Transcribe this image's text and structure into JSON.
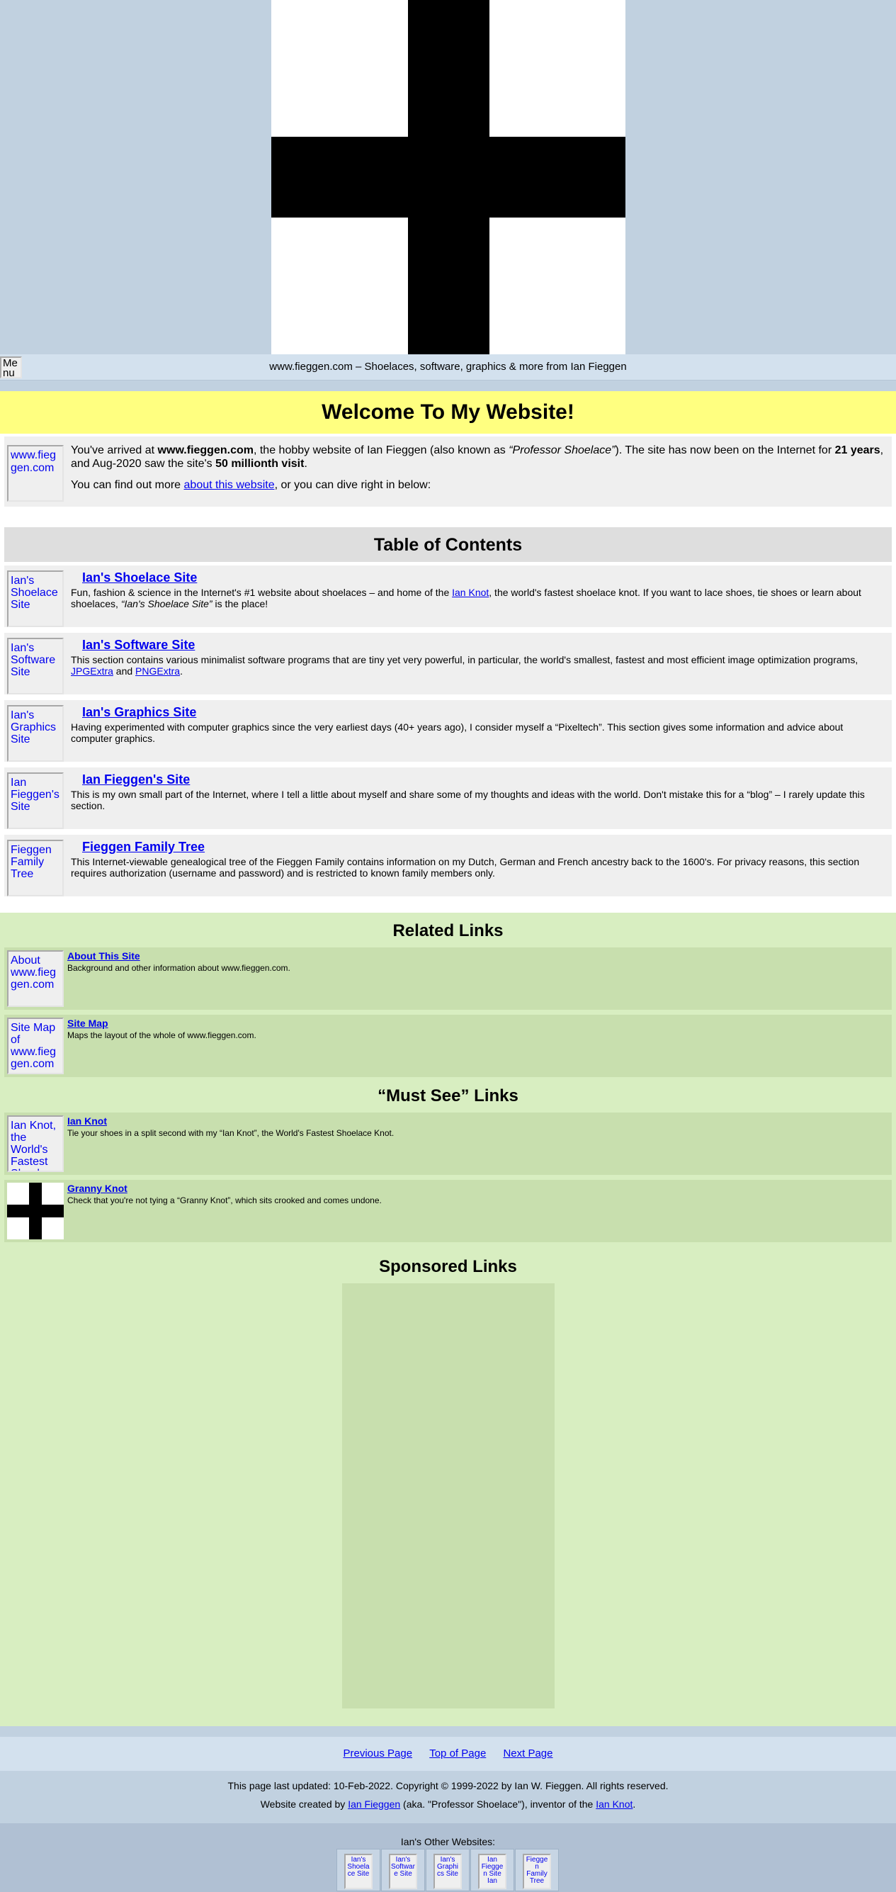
{
  "header": {
    "logo_alt": "Menu",
    "tagline": "www.fieggen.com – Shoelaces, software, graphics & more from Ian Fieggen"
  },
  "welcome": {
    "heading": "Welcome To My Website!",
    "thumb_alt": "www.fieggen.com",
    "p1_a": "You've arrived at ",
    "p1_site": "www.fieggen.com",
    "p1_b": ", the hobby website of Ian Fieggen (also known as ",
    "p1_nick": "“Professor Shoelace”",
    "p1_c": "). The site has now been on the Internet for ",
    "p1_years": "21 years",
    "p1_d": ", and Aug-2020 saw the site's ",
    "p1_visits": "50 millionth visit",
    "p1_e": ".",
    "p2_a": "You can find out more ",
    "p2_link": "about this website",
    "p2_b": ", or you can dive right in below:"
  },
  "toc": {
    "heading": "Table of Contents",
    "items": [
      {
        "thumb_alt": "Ian's Shoelace Site",
        "title": "Ian's Shoelace Site",
        "desc_a": "Fun, fashion & science in the Internet's #1 website about shoelaces – and home of the ",
        "desc_link": "Ian Knot",
        "desc_b": ", the world's fastest shoelace knot. If you want to lace shoes, tie shoes or learn about shoelaces, ",
        "desc_em": "“Ian's Shoelace Site”",
        "desc_c": " is the place!"
      },
      {
        "thumb_alt": "Ian's Software Site",
        "title": "Ian's Software Site",
        "desc_a": "This section contains various minimalist software programs that are tiny yet very powerful, in particular, the world's smallest, fastest and most efficient image optimization programs, ",
        "desc_link1": "JPGExtra",
        "desc_mid": " and ",
        "desc_link2": "PNGExtra",
        "desc_end": "."
      },
      {
        "thumb_alt": "Ian's Graphics Site",
        "title": "Ian's Graphics Site",
        "desc": "Having experimented with computer graphics since the very earliest days (40+ years ago), I consider myself a “Pixeltech”. This section gives some information and advice about computer graphics."
      },
      {
        "thumb_alt": "Ian Fieggen's Site",
        "title": "Ian Fieggen's Site",
        "desc": "This is my own small part of the Internet, where I tell a little about myself and share some of my thoughts and ideas with the world. Don't mistake this for a “blog” – I rarely update this section."
      },
      {
        "thumb_alt": "Fieggen Family Tree",
        "title": "Fieggen Family Tree",
        "desc": "This Internet-viewable genealogical tree of the Fieggen Family contains information on my Dutch, German and French ancestry back to the 1600's. For privacy reasons, this section requires authorization (username and password) and is restricted to known family members only."
      }
    ]
  },
  "related": {
    "heading": "Related Links",
    "items": [
      {
        "thumb_alt": "About www.fieggen.com",
        "title": "About This Site",
        "desc": "Background and other information about www.fieggen.com."
      },
      {
        "thumb_alt": "Site Map of www.fieggen.com",
        "title": "Site Map",
        "desc": "Maps the layout of the whole of www.fieggen.com."
      }
    ]
  },
  "must_see": {
    "heading": "“Must See” Links",
    "items": [
      {
        "thumb_alt": "Ian Knot, the World's Fastest Shoelace Knot",
        "title": "Ian Knot",
        "desc": "Tie your shoes in a split second with my “Ian Knot”, the World's Fastest Shoelace Knot."
      },
      {
        "title": "Granny Knot",
        "desc": "Check that you're not tying a “Granny Knot”, which sits crooked and comes undone."
      }
    ]
  },
  "sponsored": {
    "heading": "Sponsored Links"
  },
  "nav": {
    "previous": "Previous Page",
    "top": "Top of Page",
    "next": "Next Page"
  },
  "footer": {
    "updated": "This page last updated: 10-Feb-2022. Copyright © 1999-2022 by Ian W. Fieggen. All rights reserved.",
    "created_a": "Website created by ",
    "created_link1": "Ian Fieggen",
    "created_b": " (aka. \"Professor Shoelace\"), inventor of the ",
    "created_link2": "Ian Knot",
    "created_c": ".",
    "other_label": "Ian's Other Websites:",
    "other_sites": [
      "Ian's Shoelace Site",
      "Ian's Software Site",
      "Ian's Graphics Site",
      "Ian Fieggen Site Ian",
      "Fieggen Family Tree"
    ]
  }
}
